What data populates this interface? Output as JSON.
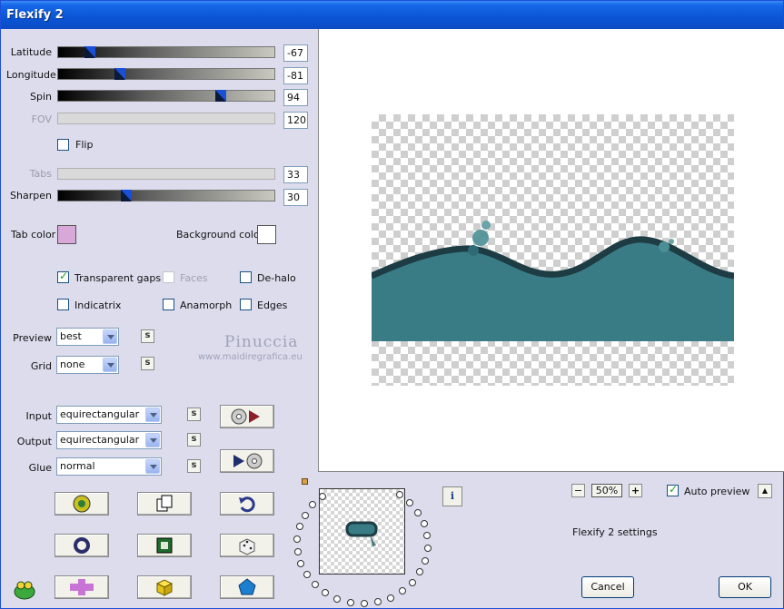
{
  "window": {
    "title": "Flexify 2"
  },
  "params": {
    "latitude": {
      "label": "Latitude",
      "value": "-67",
      "level": 0.15
    },
    "longitude": {
      "label": "Longitude",
      "value": "-81",
      "level": 0.28
    },
    "spin": {
      "label": "Spin",
      "value": "94",
      "level": 0.75
    },
    "fov": {
      "label": "FOV",
      "value": "120"
    },
    "flip": {
      "label": "Flip",
      "checked": false
    },
    "tabs": {
      "label": "Tabs",
      "value": "33"
    },
    "sharpen": {
      "label": "Sharpen",
      "value": "30",
      "level": 0.31
    }
  },
  "colors": {
    "tab_color_label": "Tab color",
    "tab_color": "#d8a8d8",
    "background_color_label": "Background color",
    "background_color": "#ffffff"
  },
  "options": {
    "transparent_gaps": {
      "label": "Transparent gaps",
      "checked": true
    },
    "faces": {
      "label": "Faces",
      "checked": false
    },
    "de_halo": {
      "label": "De-halo",
      "checked": false
    },
    "indicatrix": {
      "label": "Indicatrix",
      "checked": false
    },
    "anamorph": {
      "label": "Anamorph",
      "checked": false
    },
    "edges": {
      "label": "Edges",
      "checked": false
    }
  },
  "dropdowns": {
    "preview": {
      "label": "Preview",
      "value": "best"
    },
    "grid": {
      "label": "Grid",
      "value": "none"
    },
    "input": {
      "label": "Input",
      "value": "equirectangular"
    },
    "output": {
      "label": "Output",
      "value": "equirectangular"
    },
    "glue": {
      "label": "Glue",
      "value": "normal"
    }
  },
  "small_button_label": "s",
  "watermark": {
    "name": "Pinuccia",
    "url": "www.maidiregrafica.eu"
  },
  "zoom": {
    "minus": "−",
    "value": "50%",
    "plus": "+"
  },
  "auto_preview": {
    "label": "Auto preview",
    "checked": true,
    "up": "▲"
  },
  "settings_text": "Flexify 2 settings",
  "buttons": {
    "cancel": "Cancel",
    "ok": "OK"
  },
  "info_label": "i",
  "accent_colors": {
    "title_bar": "#0a55d6",
    "wave": "#3a7c86",
    "wave_dark": "#1d3c44"
  }
}
